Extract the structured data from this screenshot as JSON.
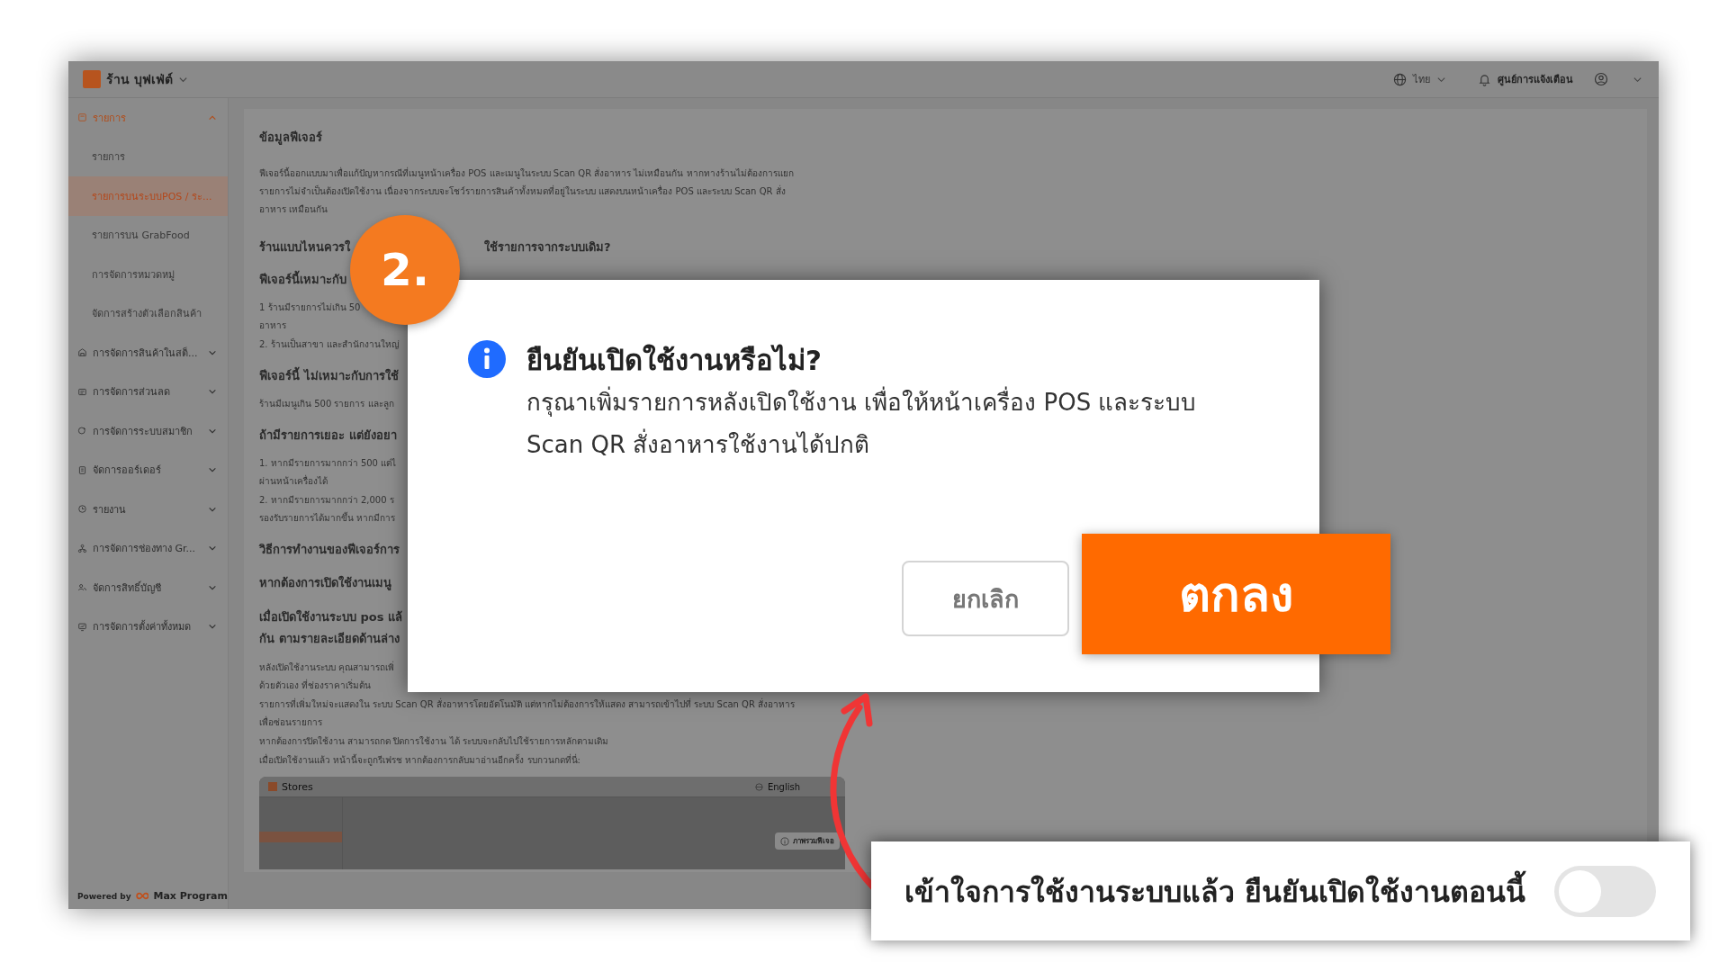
{
  "app": {
    "store_name": "ร้าน บุฟเฟ่ต์",
    "language": "ไทย",
    "notifications": "ศูนย์การแจ้งเตือน"
  },
  "sidebar": {
    "items": [
      {
        "label": "รายการ",
        "expanded": true,
        "selected": false,
        "children": [
          {
            "label": "รายการ",
            "selected": false
          },
          {
            "label": "รายการบนระบบPOS / ระ...",
            "selected": true
          },
          {
            "label": "รายการบน GrabFood",
            "selected": false
          },
          {
            "label": "การจัดการหมวดหมู่",
            "selected": false
          },
          {
            "label": "จัดการสร้างตัวเลือกสินค้า",
            "selected": false
          }
        ]
      },
      {
        "label": "การจัดการสินค้าในสต็...",
        "expanded": false,
        "selected": false
      },
      {
        "label": "การจัดการส่วนลด",
        "expanded": false,
        "selected": false
      },
      {
        "label": "การจัดการระบบสมาชิก",
        "expanded": false,
        "selected": false
      },
      {
        "label": "จัดการออร์เดอร์",
        "expanded": false,
        "selected": false
      },
      {
        "label": "รายงาน",
        "expanded": false,
        "selected": false
      },
      {
        "label": "การจัดการช่องทาง Gr...",
        "expanded": false,
        "selected": false
      },
      {
        "label": "จัดการสิทธิ์บัญชี",
        "expanded": false,
        "selected": false
      },
      {
        "label": "การจัดการตั้งค่าทั้งหมด",
        "expanded": false,
        "selected": false
      }
    ],
    "footer": {
      "powered_by": "Powered by",
      "brand": "Max Program"
    }
  },
  "content": {
    "blocks": [
      {
        "kind": "title",
        "lines": [
          "ข้อมูลฟีเจอร์"
        ]
      },
      {
        "kind": "para",
        "lines": [
          "ฟีเจอร์นี้ออกแบบมาเพื่อแก้ปัญหากรณีที่เมนูหน้าเครื่อง POS และเมนูในระบบ Scan QR สั่งอาหาร ไม่เหมือนกัน หากทางร้านไม่ต้องการแยก",
          "รายการไม่จำเป็นต้องเปิดใช้งาน เนื่องจากระบบจะโชว์รายการสินค้าทั้งหมดที่อยู่ในระบบ แสดงบนหน้าเครื่อง POS และระบบ Scan QR สั่ง",
          "อาหาร เหมือนกัน"
        ]
      },
      {
        "kind": "split",
        "lines": [
          "ร้านแบบไหนควรใ",
          "ใช้รายการจากระบบเดิม?"
        ]
      },
      {
        "kind": "heading",
        "lines": [
          "ฟีเจอร์นี้เหมาะกับ"
        ]
      },
      {
        "kind": "para",
        "lines": [
          "1 ร้านมีรายการไม่เกิน 50",
          "อาหาร"
        ]
      },
      {
        "kind": "para",
        "lines": [
          "2. ร้านเป็นสาขา และสำนักงานใหญ่"
        ]
      },
      {
        "kind": "heading",
        "lines": [
          "ฟีเจอร์นี้ ไม่เหมาะกับการใช้"
        ]
      },
      {
        "kind": "para",
        "lines": [
          "ร้านมีเมนูเกิน 500 รายการ และลูก"
        ]
      },
      {
        "kind": "heading",
        "lines": [
          "ถ้ามีรายการเยอะ แต่ยังอยา"
        ]
      },
      {
        "kind": "para",
        "lines": [
          "1. หากมีรายการมากกว่า 500 แต่ไ",
          "ผ่านหน้าเครื่องได้"
        ]
      },
      {
        "kind": "para",
        "lines": [
          "2. หากมีรายการมากกว่า 2,000 ร",
          "รองรับรายการได้มากขึ้น หากมีการ"
        ]
      },
      {
        "kind": "heading",
        "lines": [
          "วิธีการทำงานของฟีเจอร์การ"
        ]
      },
      {
        "kind": "heading-lg",
        "lines": [
          "หากต้องการเปิดใช้งานเมนู"
        ]
      },
      {
        "kind": "heading-lg",
        "lines": [
          "เมื่อเปิดใช้งานระบบ pos แล้",
          "กัน ตามรายละเอียดด้านล่าง"
        ]
      },
      {
        "kind": "para",
        "lines": [
          "หลังเปิดใช้งานระบบ คุณสามารถเพิ่",
          "ด้วยตัวเอง ที่ช่องราคาเริ่มต้น"
        ]
      },
      {
        "kind": "para",
        "lines": [
          "รายการที่เพิ่มใหม่จะแสดงใน ระบบ Scan QR สั่งอาหารโดยอัตโนมัติ แต่หากไม่ต้องการให้แสดง สามารถเข้าไปที่ ระบบ Scan QR สั่งอาหาร",
          "เพื่อซ่อนรายการ"
        ]
      },
      {
        "kind": "para",
        "lines": [
          "หากต้องการปิดใช้งาน สามารถกด ปิดการใช้งาน ได้ ระบบจะกลับไปใช้รายการหลักตามเดิม"
        ]
      },
      {
        "kind": "para",
        "lines": [
          "เมื่อเปิดใช้งานแล้ว หน้านี้จะถูกรีเฟรช หากต้องการกลับมาอ่านอีกครั้ง รบกวนกดที่นี่:"
        ]
      }
    ],
    "preview": {
      "title": "Stores",
      "language": "English",
      "button": "ภาพรวมฟีเจอ"
    }
  },
  "badge": {
    "text": "2."
  },
  "dialog": {
    "title": "ยืนยันเปิดใช้งานหรือไม่?",
    "message": "กรุณาเพิ่มรายการหลังเปิดใช้งาน เพื่อให้หน้าเครื่อง POS และระบบ Scan QR สั่งอาหารใช้งานได้ปกติ",
    "buttons": [
      {
        "label": "ยกเลิก",
        "kind": "cancel"
      },
      {
        "label": "ตกลง",
        "kind": "primary"
      }
    ]
  },
  "callout": {
    "text": "เข้าใจการใช้งานระบบแล้ว ยืนยันเปิดใช้งานตอนนี้",
    "on": false
  }
}
